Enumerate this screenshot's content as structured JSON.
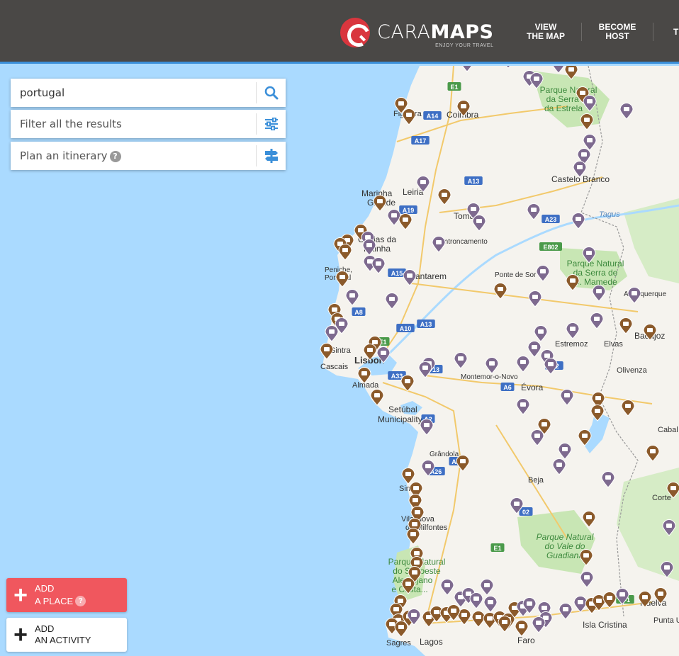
{
  "header": {
    "logo_word_light": "CARA",
    "logo_word_bold": "MAPS",
    "logo_tagline": "ENJOY YOUR TRAVEL",
    "nav": [
      {
        "label": "VIEW\nTHE MAP"
      },
      {
        "label": "BECOME\nHOST"
      },
      {
        "label": "T"
      }
    ]
  },
  "search": {
    "value": "portugal",
    "filter_label": "Filter all the results",
    "itinerary_label": "Plan an itinerary",
    "help": "?"
  },
  "buttons": {
    "add_place": "ADD\nA PLACE",
    "add_activity": "ADD\nAN ACTIVITY",
    "help": "?"
  },
  "map": {
    "cities": [
      {
        "id": "coimbra",
        "label": "Coimbra"
      },
      {
        "id": "castelo",
        "label": "Castelo Branco"
      },
      {
        "id": "leiria",
        "label": "Leiria"
      },
      {
        "id": "marinha",
        "label": "Marinha\nGrande"
      },
      {
        "id": "tomar",
        "label": "Tomar"
      },
      {
        "id": "entroncamento",
        "label": "Entroncamento"
      },
      {
        "id": "caldas",
        "label": "Caldas da\nRainha"
      },
      {
        "id": "peniche",
        "label": "Peniche,\nPortugal"
      },
      {
        "id": "santarem",
        "label": "Santarem"
      },
      {
        "id": "pontedesor",
        "label": "Ponte de Sor"
      },
      {
        "id": "alburquerque",
        "label": "Alburquerque"
      },
      {
        "id": "badajoz",
        "label": "Badajoz"
      },
      {
        "id": "elvas",
        "label": "Elvas"
      },
      {
        "id": "estremoz",
        "label": "Estremoz"
      },
      {
        "id": "olivenza",
        "label": "Olivenza"
      },
      {
        "id": "sintra",
        "label": "Sintra"
      },
      {
        "id": "cascais",
        "label": "Cascais"
      },
      {
        "id": "lisbon",
        "label": "Lisbon"
      },
      {
        "id": "almada",
        "label": "Almada"
      },
      {
        "id": "montemor",
        "label": "Montemor-o-Novo"
      },
      {
        "id": "evora",
        "label": "Évora"
      },
      {
        "id": "setubal",
        "label": "Setúbal\nMunicipality"
      },
      {
        "id": "grandola",
        "label": "Grândola"
      },
      {
        "id": "beja",
        "label": "Beja"
      },
      {
        "id": "sines",
        "label": "Sines"
      },
      {
        "id": "vilanova",
        "label": "Vila Nova\nde Milfontes"
      },
      {
        "id": "huelva",
        "label": "Huelva"
      },
      {
        "id": "isla",
        "label": "Isla Cristina"
      },
      {
        "id": "punta",
        "label": "Punta U"
      },
      {
        "id": "lagos",
        "label": "Lagos"
      },
      {
        "id": "faro",
        "label": "Faro"
      },
      {
        "id": "sagres",
        "label": "Sagres"
      },
      {
        "id": "figueira",
        "label": "Figueira"
      },
      {
        "id": "cortes",
        "label": "Corte"
      },
      {
        "id": "cabal",
        "label": "Cabal"
      }
    ],
    "parks": [
      {
        "id": "estrela",
        "label": "Parque Natural\nda Serra da\nda Estrela"
      },
      {
        "id": "mamede",
        "label": "Parque Natural\nda Serra de\nS. Mamede"
      },
      {
        "id": "guadiana",
        "label": "Parque Natural\ndo Vale do\nGuadiana"
      },
      {
        "id": "sudoeste",
        "label": "Parque Natural\ndo Sudoeste\nAlentejano\ne Costa..."
      }
    ],
    "river": "Tagus",
    "roads": [
      "E1",
      "A14",
      "A17",
      "A13",
      "A19",
      "A23",
      "E802",
      "A15",
      "A8",
      "A10",
      "A13",
      "E1",
      "A33",
      "A6",
      "A2",
      "A26",
      "A2",
      "E1",
      "E-1",
      "IP2",
      "13",
      "02"
    ],
    "colors": {
      "sea": "#aadaff",
      "land": "#f5f3ee",
      "park": "#c8e6b4",
      "pin_purple": "#7e6a8f",
      "pin_brown": "#8b5a2b",
      "accent": "#f0575e"
    }
  }
}
